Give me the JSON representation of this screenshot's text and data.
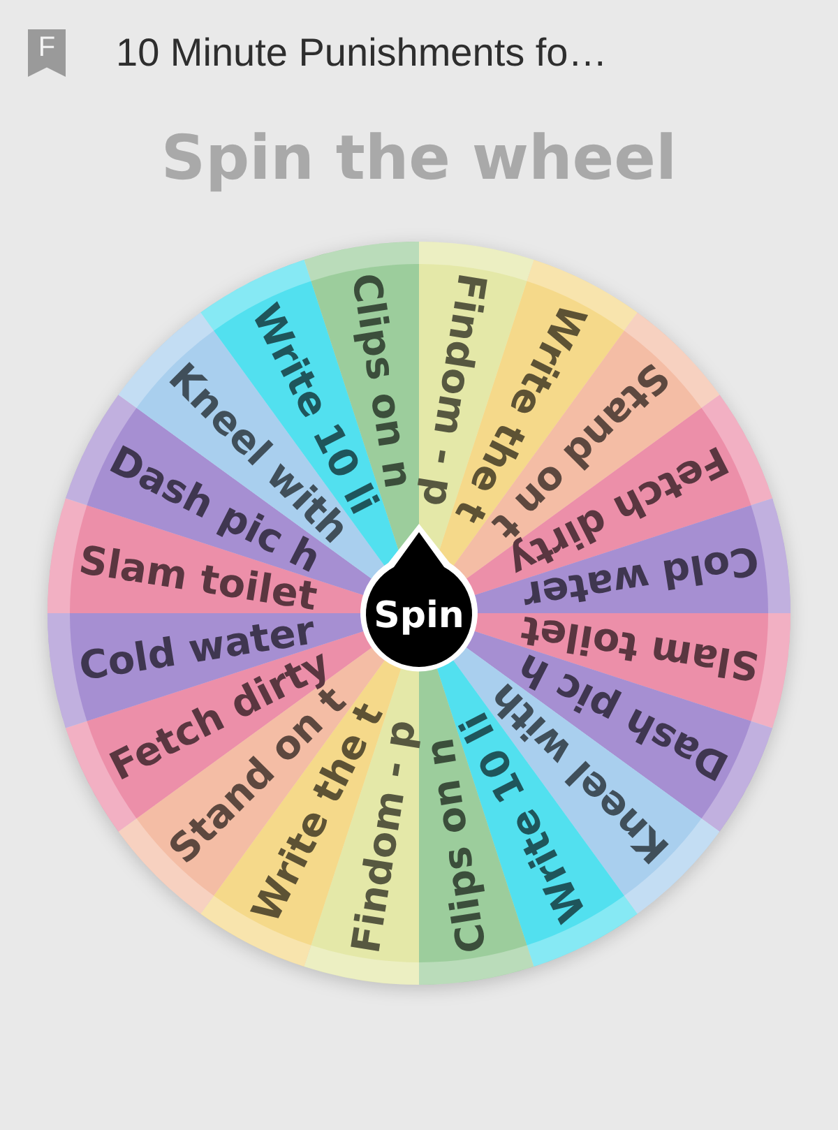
{
  "header": {
    "badge_letter": "F",
    "title": "10 Minute Punishments fo…"
  },
  "heading": "Spin the wheel",
  "wheel": {
    "spin_label": "Spin",
    "segments": [
      {
        "label": "Findom - p",
        "color": "#e4e8a8"
      },
      {
        "label": "Write the t",
        "color": "#f5d98a"
      },
      {
        "label": "Stand on t",
        "color": "#f4bda5"
      },
      {
        "label": "Fetch dirty",
        "color": "#ec8fa9"
      },
      {
        "label": "Cold water",
        "color": "#a68fd2"
      },
      {
        "label": "Slam toilet",
        "color": "#ec8fa9"
      },
      {
        "label": "Dash pic h",
        "color": "#a68fd2"
      },
      {
        "label": "Kneel with",
        "color": "#a9cfee"
      },
      {
        "label": "Write 10 li",
        "color": "#52e0ef"
      },
      {
        "label": "Clips on n",
        "color": "#9ccd9c"
      },
      {
        "label": "Findom - p",
        "color": "#e4e8a8"
      },
      {
        "label": "Write the t",
        "color": "#f5d98a"
      },
      {
        "label": "Stand on t",
        "color": "#f4bda5"
      },
      {
        "label": "Fetch dirty",
        "color": "#ec8fa9"
      },
      {
        "label": "Cold water",
        "color": "#a68fd2"
      },
      {
        "label": "Slam toilet",
        "color": "#ec8fa9"
      },
      {
        "label": "Dash pic h",
        "color": "#a68fd2"
      },
      {
        "label": "Kneel with",
        "color": "#a9cfee"
      },
      {
        "label": "Write 10 li",
        "color": "#52e0ef"
      },
      {
        "label": "Clips on n",
        "color": "#9ccd9c"
      }
    ]
  }
}
